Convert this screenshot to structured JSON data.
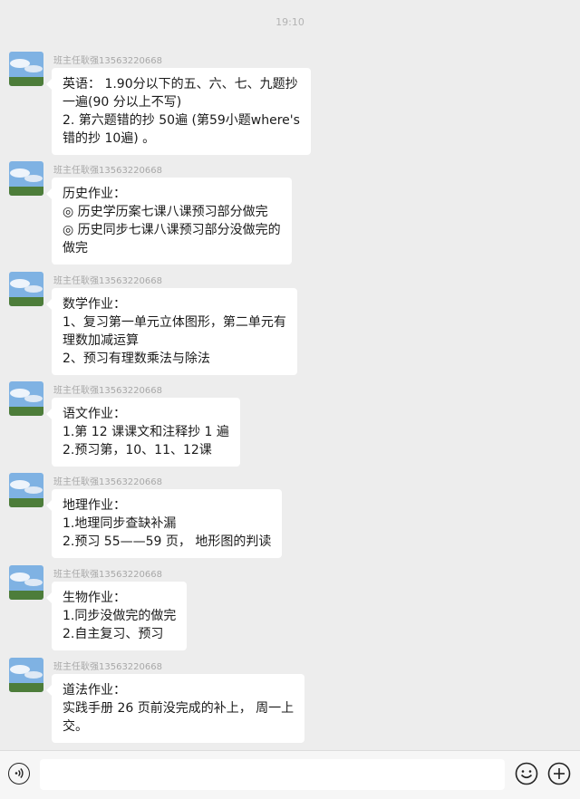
{
  "chat": {
    "timestamp": "19:10",
    "messages": [
      {
        "sender": "班主任耿强13563220668",
        "lines": [
          "英语： 1.90分以下的五、六、七、九题抄",
          "一遍(90 分以上不写)",
          "2. 第六题错的抄 50遍 (第59小题where's",
          "错的抄 10遍) 。"
        ]
      },
      {
        "sender": "班主任耿强13563220668",
        "lines": [
          "历史作业：",
          "◎ 历史学历案七课八课预习部分做完",
          "◎ 历史同步七课八课预习部分没做完的",
          "做完"
        ]
      },
      {
        "sender": "班主任耿强13563220668",
        "lines": [
          "数学作业：",
          "1、复习第一单元立体图形，第二单元有",
          "理数加减运算",
          "2、预习有理数乘法与除法"
        ]
      },
      {
        "sender": "班主任耿强13563220668",
        "lines": [
          "语文作业：",
          "1.第 12 课课文和注释抄 1 遍",
          "2.预习第，10、11、12课"
        ]
      },
      {
        "sender": "班主任耿强13563220668",
        "lines": [
          "地理作业：",
          "1.地理同步查缺补漏",
          "2.预习 55——59 页， 地形图的判读"
        ]
      },
      {
        "sender": "班主任耿强13563220668",
        "lines": [
          "生物作业：",
          "1.同步没做完的做完",
          "2.自主复习、预习"
        ]
      },
      {
        "sender": "班主任耿强13563220668",
        "lines": [
          "道法作业：",
          "实践手册 26 页前没完成的补上， 周一上",
          "交。"
        ]
      }
    ]
  },
  "input_bar": {
    "voice_icon": "voice-icon",
    "emoji_icon": "emoji-icon",
    "plus_icon": "plus-icon"
  },
  "colors": {
    "background": "#ededed",
    "bubble": "#ffffff",
    "text": "#1a1a1a",
    "meta": "#a8a8a8"
  }
}
